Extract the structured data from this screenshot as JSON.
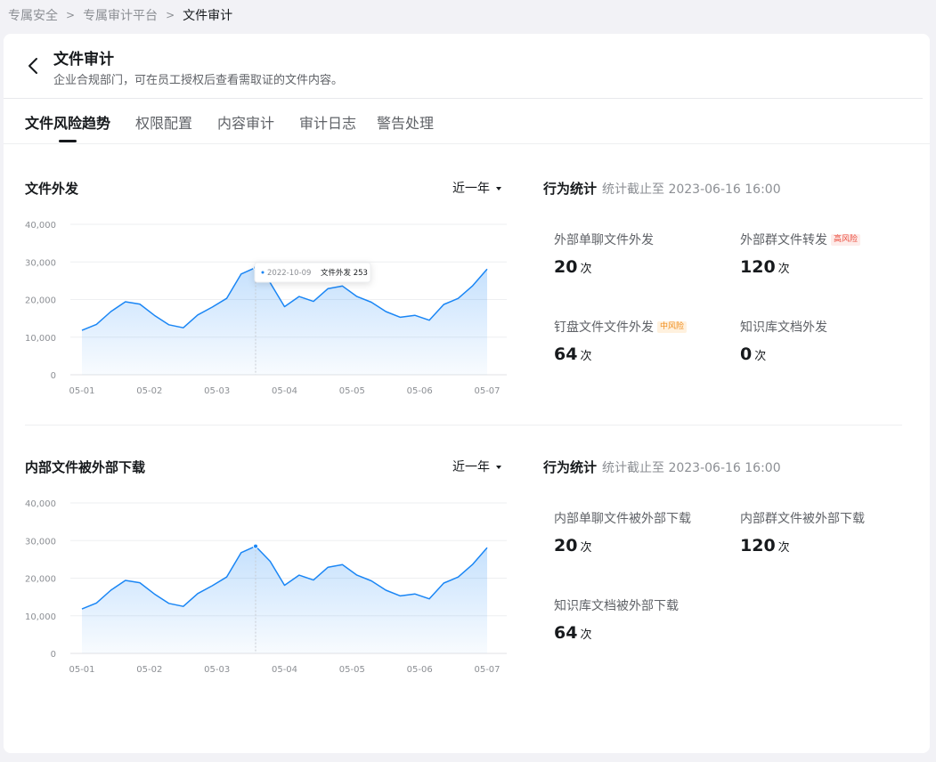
{
  "breadcrumb": {
    "items": [
      "专属安全",
      "专属审计平台"
    ],
    "current": "文件审计"
  },
  "header": {
    "title": "文件审计",
    "description": "企业合规部门，可在员工授权后查看需取证的文件内容。"
  },
  "tabs": [
    {
      "label": "文件风险趋势",
      "active": true
    },
    {
      "label": "权限配置"
    },
    {
      "label": "内容审计"
    },
    {
      "label": "审计日志"
    },
    {
      "label": "警告处理"
    }
  ],
  "section1": {
    "title": "文件外发",
    "range": "近一年",
    "stats": {
      "title": "行为统计",
      "subtitle": "统计截止至 2023-06-16 16:00",
      "metrics": [
        {
          "label": "外部单聊文件外发",
          "value": "20",
          "unit": "次"
        },
        {
          "label": "外部群文件转发",
          "value": "120",
          "unit": "次",
          "badge": "高风险"
        },
        {
          "label": "钉盘文件文件外发",
          "value": "64",
          "unit": "次",
          "badge": "中风险"
        },
        {
          "label": "知识库文档外发",
          "value": "0",
          "unit": "次"
        }
      ]
    }
  },
  "section2": {
    "title": "内部文件被外部下载",
    "range": "近一年",
    "stats": {
      "title": "行为统计",
      "subtitle": "统计截止至 2023-06-16 16:00",
      "metrics": [
        {
          "label": "内部单聊文件被外部下载",
          "value": "20",
          "unit": "次"
        },
        {
          "label": "内部群文件被外部下载",
          "value": "120",
          "unit": "次"
        },
        {
          "label": "知识库文档被外部下载",
          "value": "64",
          "unit": "次"
        }
      ]
    }
  },
  "colors": {
    "line": "#1a86f5",
    "high_risk": "#ea4b3c",
    "mid_risk": "#f08c1a"
  },
  "icons": {
    "back": "chevron-left-icon",
    "dropdown": "caret-down-icon"
  },
  "chart_data": [
    {
      "type": "area",
      "categories": [
        "05-01",
        "05-02",
        "05-03",
        "05-04",
        "05-05",
        "05-06",
        "05-07"
      ],
      "yticks": [
        "40,000",
        "30,000",
        "20,000",
        "10,000",
        "0"
      ],
      "ylim": [
        0,
        40000
      ],
      "x": [
        0,
        0.2,
        0.4,
        0.6,
        0.8,
        1.0,
        1.2,
        1.4,
        1.6,
        1.8,
        2.0,
        2.2,
        2.4,
        2.6,
        2.8,
        3.0,
        3.2,
        3.4,
        3.6,
        3.8,
        4.0,
        4.2,
        4.4,
        4.6,
        4.8,
        5.0,
        5.2,
        5.4,
        5.6,
        5.8,
        6.0
      ],
      "series": [
        {
          "values": [
            11800,
            13400,
            16800,
            19400,
            18800,
            15800,
            13300,
            12500,
            15900,
            18000,
            20300,
            26800,
            28500,
            24500,
            18100,
            20800,
            19500,
            22900,
            23600,
            20800,
            19300,
            16800,
            15300,
            15800,
            14500,
            18700,
            20300,
            23700,
            28100
          ]
        }
      ],
      "tooltip": {
        "date": "2022-10-09",
        "label": "文件外发",
        "value": "253",
        "index": 12
      }
    },
    {
      "type": "area",
      "categories": [
        "05-01",
        "05-02",
        "05-03",
        "05-04",
        "05-05",
        "05-06",
        "05-07"
      ],
      "yticks": [
        "40,000",
        "30,000",
        "20,000",
        "10,000",
        "0"
      ],
      "ylim": [
        0,
        40000
      ],
      "series": [
        {
          "values": [
            11800,
            13400,
            16800,
            19400,
            18800,
            15800,
            13300,
            12500,
            15900,
            18000,
            20300,
            26800,
            28500,
            24500,
            18100,
            20800,
            19500,
            22900,
            23600,
            20800,
            19300,
            16800,
            15300,
            15800,
            14500,
            18700,
            20300,
            23700,
            28100
          ]
        }
      ],
      "highlight_index": 12
    }
  ]
}
